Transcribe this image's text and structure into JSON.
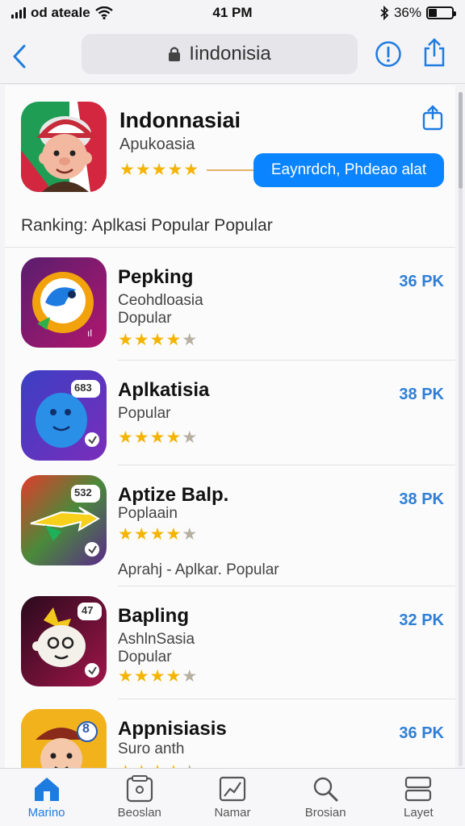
{
  "status": {
    "carrier": "od ateale",
    "time": "41 PM",
    "battery": "36%",
    "battery_level": 0.36
  },
  "nav": {
    "url": "Iindonisia"
  },
  "featured": {
    "title": "Indonnasiai",
    "subtitle": "Apukoasia",
    "rating": 5,
    "button_label": "Eaynrdch, Phdeao alat"
  },
  "section": {
    "heading": "Ranking: Aplkasi Popular Popular"
  },
  "apps": [
    {
      "title": "Pepking",
      "line1": "Ceohdloasia",
      "line2": "Dopular",
      "price": "36 PK",
      "rating": 4.5
    },
    {
      "title": "Aplkatisia",
      "line1": "Popular",
      "line2": "",
      "price": "38 PK",
      "rating": 4.5,
      "badge": "683"
    },
    {
      "title": "Aptize Balp.",
      "line1": "Poplaain",
      "line2": "",
      "price": "38 PK",
      "rating": 4.5,
      "badge": "532",
      "extra": "Aprahj - Aplkar. Popular"
    },
    {
      "title": "Bapling",
      "line1": "AshlnSasia",
      "line2": "Dopular",
      "price": "32 PK",
      "rating": 4.5,
      "badge": "47"
    },
    {
      "title": "Appnisiasis",
      "line1": "Suro anth",
      "line2": "",
      "price": "36 PK",
      "rating": 4.5,
      "badge": "8"
    }
  ],
  "tabs": [
    {
      "label": "Marino",
      "icon": "home-icon",
      "active": true
    },
    {
      "label": "Beoslan",
      "icon": "frame-icon",
      "active": false
    },
    {
      "label": "Namar",
      "icon": "chart-icon",
      "active": false
    },
    {
      "label": "Brosian",
      "icon": "search-icon",
      "active": false
    },
    {
      "label": "Layet",
      "icon": "layers-icon",
      "active": false
    }
  ],
  "colors": {
    "accent": "#0a84ff",
    "price": "#2f7fd6",
    "star": "#f4b400"
  }
}
